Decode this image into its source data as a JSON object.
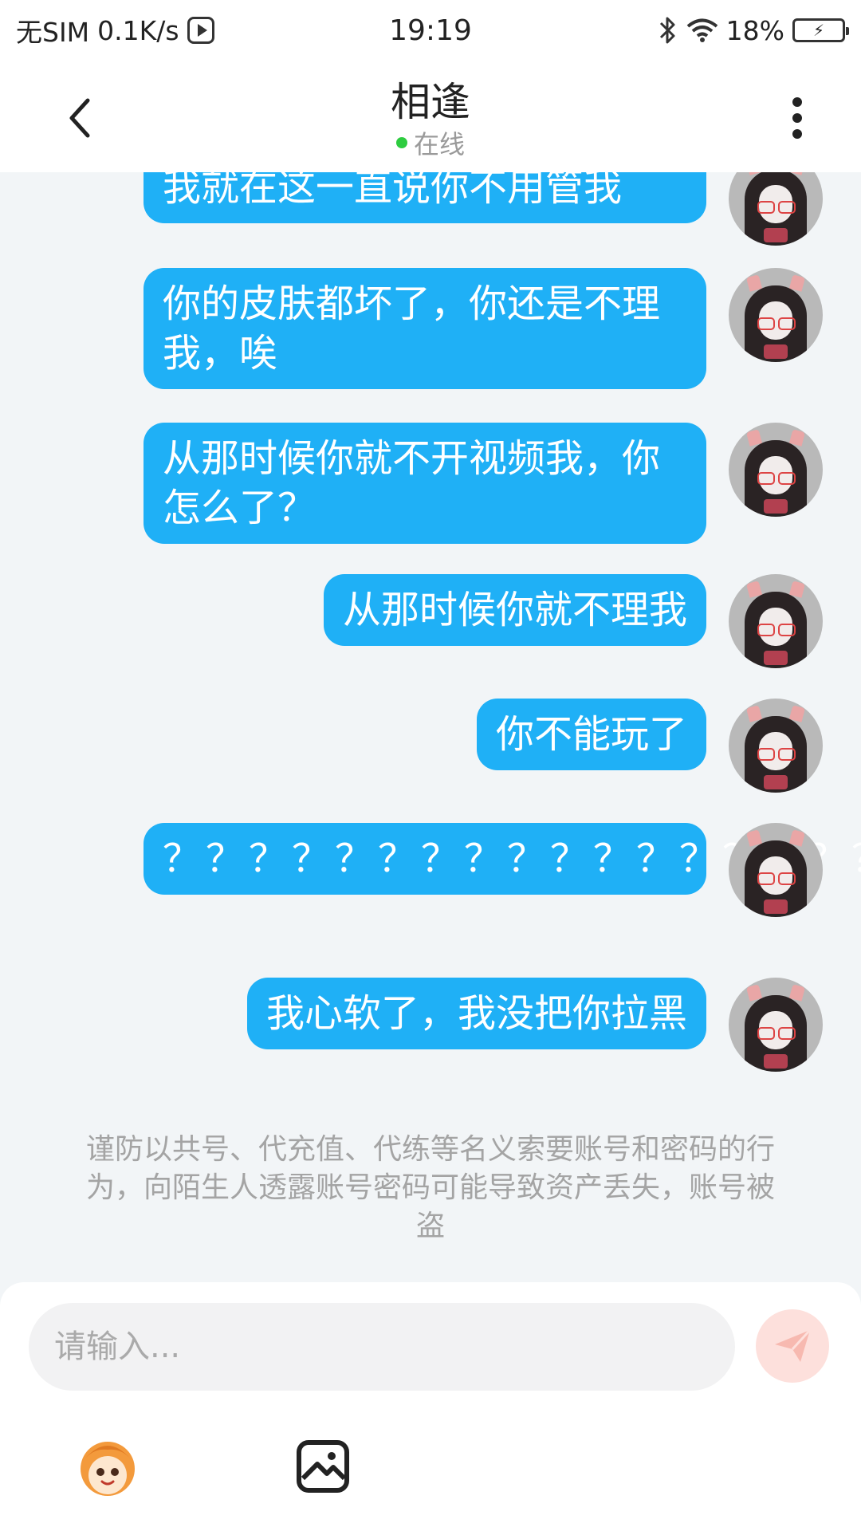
{
  "status_bar": {
    "carrier": "无SIM",
    "speed": "0.1K/s",
    "time": "19:19",
    "battery": "18%"
  },
  "header": {
    "title": "相逢",
    "status": "在线"
  },
  "messages": [
    {
      "text": "我就在这一直说你不用管我"
    },
    {
      "text": "你的皮肤都坏了，你还是不理我，唉"
    },
    {
      "text": "从那时候你就不开视频我，你怎么了？"
    },
    {
      "text": "从那时候你就不理我"
    },
    {
      "text": "你不能玩了"
    },
    {
      "text": "？？？？？？？？？？？？？？？？？？？？？？"
    },
    {
      "text": "我心软了，我没把你拉黑"
    }
  ],
  "notice": "谨防以共号、代充值、代练等名义索要账号和密码的行为，向陌生人透露账号密码可能导致资产丢失，账号被盗",
  "composer": {
    "placeholder": "请输入..."
  },
  "colors": {
    "bubble": "#1fb0f6",
    "online": "#2ecc40",
    "send": "#fde0dc"
  },
  "icons": [
    "back-icon",
    "more-icon",
    "play-icon",
    "bluetooth-icon",
    "wifi-icon",
    "battery-icon",
    "send-icon",
    "emoji-icon",
    "image-icon"
  ]
}
